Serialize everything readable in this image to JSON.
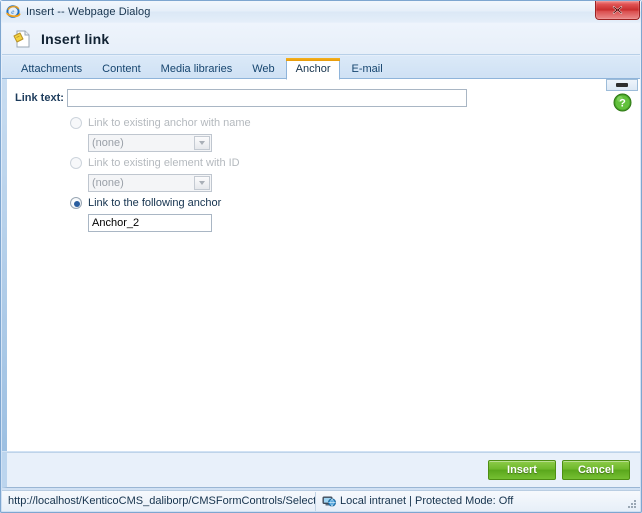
{
  "window": {
    "title": "Insert -- Webpage Dialog",
    "icon": "ie-logo-icon",
    "close_label": "Close"
  },
  "header": {
    "title": "Insert link",
    "icon": "insert-link-document-icon"
  },
  "tabs": [
    {
      "label": "Attachments",
      "active": false
    },
    {
      "label": "Content",
      "active": false
    },
    {
      "label": "Media libraries",
      "active": false
    },
    {
      "label": "Web",
      "active": false
    },
    {
      "label": "Anchor",
      "active": true
    },
    {
      "label": "E-mail",
      "active": false
    }
  ],
  "form": {
    "link_text_label": "Link text:",
    "link_text_value": "",
    "link_text_placeholder": "",
    "options": [
      {
        "id": "existing-anchor",
        "label": "Link to existing anchor with name",
        "selected": false,
        "disabled": true,
        "dropdown_value": "(none)"
      },
      {
        "id": "existing-element-id",
        "label": "Link to existing element with ID",
        "selected": false,
        "disabled": true,
        "dropdown_value": "(none)"
      },
      {
        "id": "following-anchor",
        "label": "Link to the following anchor",
        "selected": true,
        "disabled": false,
        "text_value": "Anchor_2"
      }
    ],
    "help_icon": "help-question-icon"
  },
  "footer": {
    "insert_label": "Insert",
    "cancel_label": "Cancel"
  },
  "statusbar": {
    "url": "http://localhost/KenticoCMS_daliborp/CMSFormControls/Selectors/Inse",
    "zone_icon": "local-intranet-icon",
    "zone": "Local intranet | Protected Mode: Off"
  },
  "colors": {
    "accent_tab": "#e79a09",
    "button_green": "#6fb92b",
    "close_red": "#c62b2b",
    "help_green": "#5bb431",
    "chrome_blue": "#cfe0f3"
  }
}
